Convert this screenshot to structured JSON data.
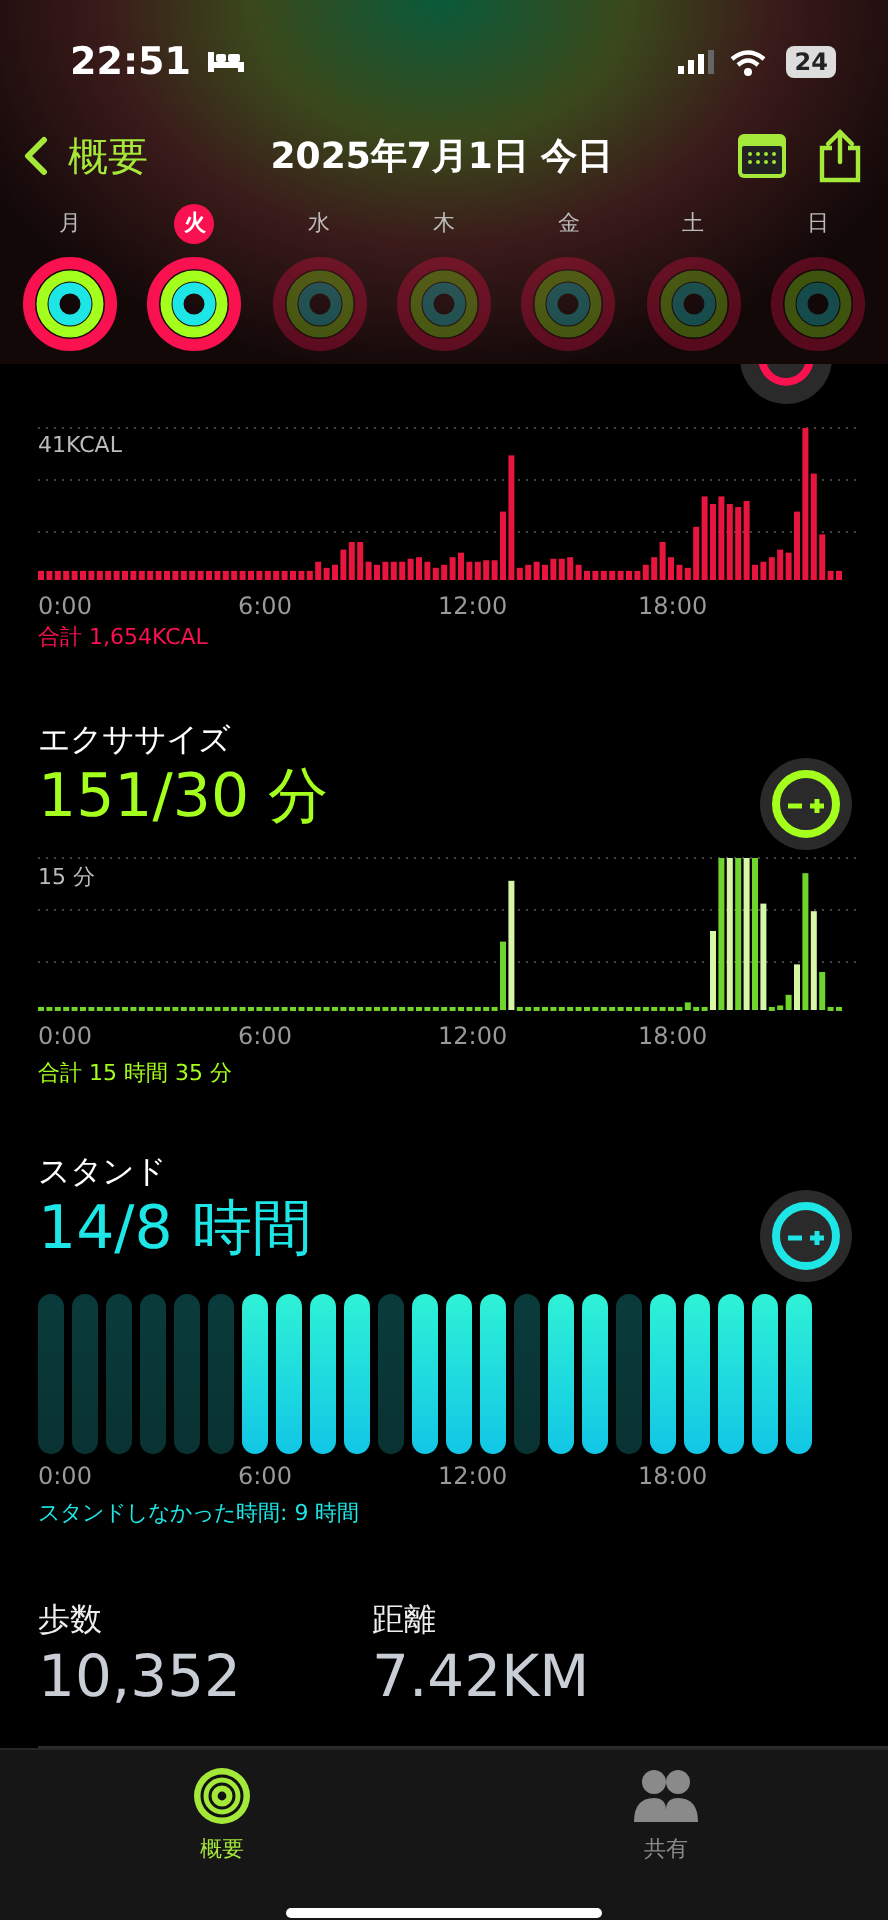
{
  "status_bar": {
    "time": "22:51",
    "battery": "24"
  },
  "nav": {
    "back": "概要",
    "title": "2025年7月1日 今日"
  },
  "week": [
    {
      "label": "月",
      "selected": false,
      "future": false
    },
    {
      "label": "火",
      "selected": true,
      "future": false
    },
    {
      "label": "水",
      "selected": false,
      "future": true
    },
    {
      "label": "木",
      "selected": false,
      "future": true
    },
    {
      "label": "金",
      "selected": false,
      "future": true
    },
    {
      "label": "土",
      "selected": false,
      "future": true
    },
    {
      "label": "日",
      "selected": false,
      "future": true
    }
  ],
  "move": {
    "scale": "41KCAL",
    "axis": [
      "0:00",
      "6:00",
      "12:00",
      "18:00"
    ],
    "total": "合計 1,654KCAL"
  },
  "exercise": {
    "title": "エクササイズ",
    "value": "151/30 分",
    "scale": "15 分",
    "axis": [
      "0:00",
      "6:00",
      "12:00",
      "18:00"
    ],
    "total": "合計 15 時間 35 分"
  },
  "stand": {
    "title": "スタンド",
    "value": "14/8 時間",
    "axis": [
      "0:00",
      "6:00",
      "12:00",
      "18:00"
    ],
    "total": "スタンドしなかった時間: 9 時間",
    "hours": [
      {
        "stood": false
      },
      {
        "stood": false
      },
      {
        "stood": false
      },
      {
        "stood": false
      },
      {
        "stood": false
      },
      {
        "stood": false
      },
      {
        "stood": true
      },
      {
        "stood": true
      },
      {
        "stood": true
      },
      {
        "stood": true
      },
      {
        "stood": false
      },
      {
        "stood": true
      },
      {
        "stood": true
      },
      {
        "stood": true
      },
      {
        "stood": false
      },
      {
        "stood": true
      },
      {
        "stood": true
      },
      {
        "stood": false
      },
      {
        "stood": true
      },
      {
        "stood": true
      },
      {
        "stood": true
      },
      {
        "stood": true
      },
      {
        "stood": true
      }
    ]
  },
  "stats": [
    {
      "label": "歩数",
      "value": "10,352"
    },
    {
      "label": "距離",
      "value": "7.42KM"
    }
  ],
  "tabs": [
    {
      "label": "概要",
      "selected": true
    },
    {
      "label": "共有",
      "selected": false
    }
  ]
}
